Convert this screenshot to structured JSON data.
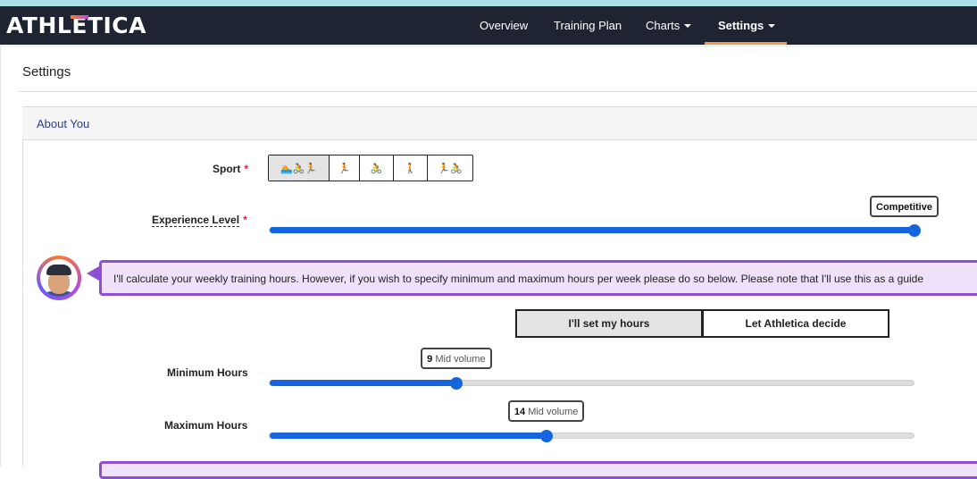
{
  "brand": {
    "logo_pre": "ATHL",
    "logo_e": "E",
    "logo_post": "TICA"
  },
  "nav": {
    "items": [
      {
        "label": "Overview"
      },
      {
        "label": "Training Plan"
      },
      {
        "label": "Charts",
        "dropdown": true
      },
      {
        "label": "Settings",
        "dropdown": true,
        "active": true
      }
    ]
  },
  "page": {
    "title": "Settings"
  },
  "panel": {
    "title": "About You"
  },
  "sport": {
    "label": "Sport",
    "required_mark": "*",
    "options": [
      {
        "icon": "triathlon-icon",
        "glyph": "🏊🚴🏃",
        "selected": true
      },
      {
        "icon": "run-icon",
        "glyph": "🏃"
      },
      {
        "icon": "bike-icon",
        "glyph": "🚴"
      },
      {
        "icon": "walk-icon",
        "glyph": "🚶"
      },
      {
        "icon": "duathlon-icon",
        "glyph": "🏃🚴"
      }
    ]
  },
  "experience": {
    "label": "Experience Level",
    "required_mark": "*",
    "value_label": "Competitive",
    "level_fraction": 1.0
  },
  "coach": {
    "avatar_icon": "coach-avatar-icon",
    "message": "I'll calculate your weekly training hours. However, if you wish to specify minimum and maximum hours per week please do so below. Please note that I'll use this as a guide"
  },
  "hours_mode": {
    "options": [
      {
        "label": "I'll set my hours",
        "selected": true
      },
      {
        "label": "Let Athletica decide",
        "selected": false
      }
    ]
  },
  "min_hours": {
    "label": "Minimum Hours",
    "value": "9",
    "unit_label": "Mid volume",
    "fraction": 0.29
  },
  "max_hours": {
    "label": "Maximum Hours",
    "value": "14",
    "unit_label": "Mid volume",
    "fraction": 0.43
  },
  "colors": {
    "navbar": "#1f2433",
    "accent_orange": "#f2994a",
    "slider_blue": "#1565e0",
    "bubble_purple": "#8e4fd4",
    "required_red": "#d9263b"
  }
}
